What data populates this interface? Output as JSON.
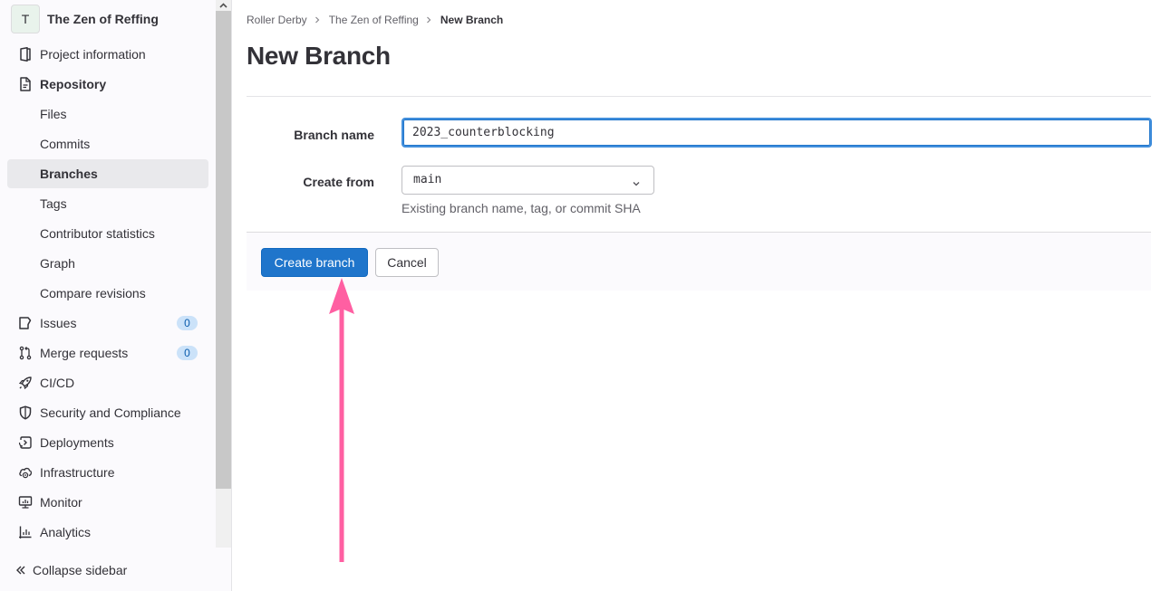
{
  "sidebar": {
    "project": {
      "avatar_letter": "T",
      "title": "The Zen of Reffing"
    },
    "items": [
      {
        "label": "Project information",
        "icon": "project-icon"
      },
      {
        "label": "Repository",
        "icon": "document-icon"
      },
      {
        "label": "Files"
      },
      {
        "label": "Commits"
      },
      {
        "label": "Branches",
        "active": true
      },
      {
        "label": "Tags"
      },
      {
        "label": "Contributor statistics"
      },
      {
        "label": "Graph"
      },
      {
        "label": "Compare revisions"
      },
      {
        "label": "Issues",
        "icon": "issues-icon",
        "badge": "0"
      },
      {
        "label": "Merge requests",
        "icon": "merge-request-icon",
        "badge": "0"
      },
      {
        "label": "CI/CD",
        "icon": "rocket-icon"
      },
      {
        "label": "Security and Compliance",
        "icon": "shield-icon"
      },
      {
        "label": "Deployments",
        "icon": "deployments-icon"
      },
      {
        "label": "Infrastructure",
        "icon": "cloud-gear-icon"
      },
      {
        "label": "Monitor",
        "icon": "monitor-icon"
      },
      {
        "label": "Analytics",
        "icon": "chart-icon"
      }
    ],
    "collapse_label": "Collapse sidebar"
  },
  "breadcrumb": {
    "items": [
      "Roller Derby",
      "The Zen of Reffing",
      "New Branch"
    ]
  },
  "page": {
    "title": "New Branch"
  },
  "form": {
    "branch_name_label": "Branch name",
    "branch_name_value": "2023_counterblocking",
    "create_from_label": "Create from",
    "create_from_value": "main",
    "create_from_help": "Existing branch name, tag, or commit SHA"
  },
  "actions": {
    "create_label": "Create branch",
    "cancel_label": "Cancel"
  },
  "colors": {
    "primary": "#1f75cb",
    "annotation_arrow": "#ff5fa2",
    "badge_bg": "#cbe2f9",
    "badge_text": "#0b5cad"
  }
}
